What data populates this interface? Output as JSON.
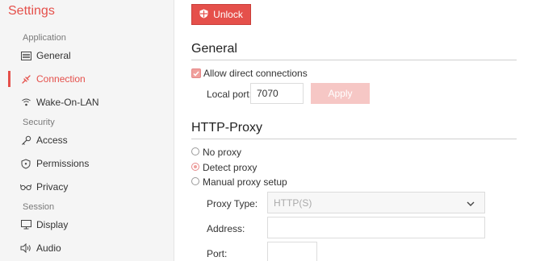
{
  "app_title": "Settings",
  "sidebar": {
    "sections": [
      {
        "label": "Application"
      },
      {
        "label": "Security"
      },
      {
        "label": "Session"
      }
    ],
    "items": [
      {
        "label": "General",
        "icon": "general-icon",
        "active": false
      },
      {
        "label": "Connection",
        "icon": "connection-icon",
        "active": true
      },
      {
        "label": "Wake-On-LAN",
        "icon": "wifi-icon",
        "active": false
      },
      {
        "label": "Access",
        "icon": "key-icon",
        "active": false
      },
      {
        "label": "Permissions",
        "icon": "shield-icon",
        "active": false
      },
      {
        "label": "Privacy",
        "icon": "glasses-icon",
        "active": false
      },
      {
        "label": "Display",
        "icon": "monitor-icon",
        "active": false
      },
      {
        "label": "Audio",
        "icon": "speaker-icon",
        "active": false
      }
    ]
  },
  "toolbar": {
    "unlock_label": "Unlock"
  },
  "general": {
    "heading": "General",
    "allow_direct_label": "Allow direct connections",
    "allow_direct_checked": true,
    "local_port_label": "Local port:",
    "local_port_value": "7070",
    "apply_label": "Apply"
  },
  "proxy": {
    "heading": "HTTP-Proxy",
    "options": [
      {
        "label": "No proxy",
        "checked": false
      },
      {
        "label": "Detect proxy",
        "checked": true
      },
      {
        "label": "Manual proxy setup",
        "checked": false
      }
    ],
    "type_label": "Proxy Type:",
    "type_value": "HTTP(S)",
    "address_label": "Address:",
    "address_value": "",
    "port_label": "Port:",
    "port_value": ""
  },
  "colors": {
    "accent": "#e5504b",
    "accent_light": "#f6c7c5",
    "sidebar_bg": "#f5f5f5"
  }
}
